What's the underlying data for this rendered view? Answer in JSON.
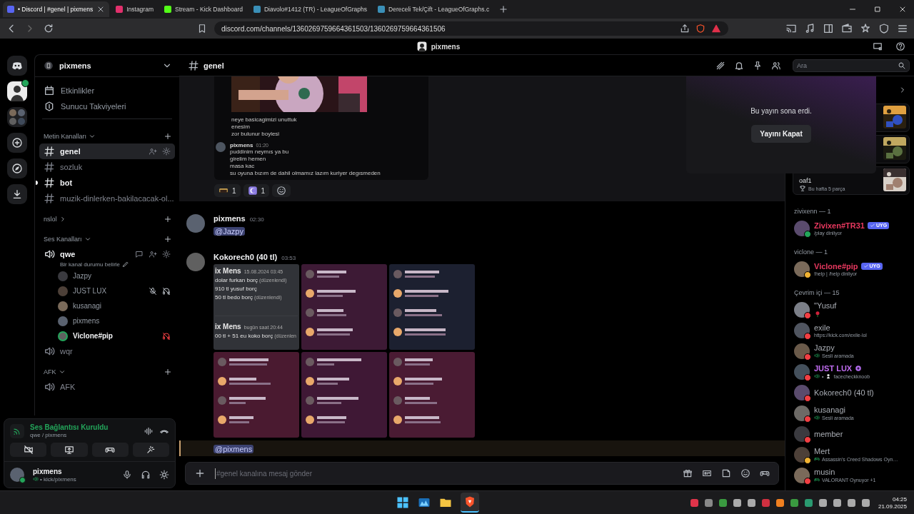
{
  "browser": {
    "tabs": [
      {
        "label": "• Discord | #genel | pixmens",
        "selected": true
      },
      {
        "label": "Instagram",
        "selected": false
      },
      {
        "label": "Stream - Kick Dashboard",
        "selected": false
      },
      {
        "label": "Diavolo#1412 (TR) - LeagueOfGraphs",
        "selected": false
      },
      {
        "label": "Dereceli Tek/Çift - LeagueOfGraphs.c",
        "selected": false
      }
    ],
    "url": "discord.com/channels/1360269759664361503/1360269759664361506"
  },
  "window_title": "pixmens",
  "server": {
    "name": "pixmens",
    "nav": [
      {
        "kind": "calendar",
        "label": "Etkinlikler"
      },
      {
        "kind": "boost",
        "label": "Sunucu Takviyeleri"
      }
    ],
    "categories": [
      {
        "name": "Metin Kanalları",
        "expanded": true,
        "channels": [
          {
            "kind": "text",
            "name": "genel",
            "selected": true,
            "unread": false
          },
          {
            "kind": "text",
            "name": "sozluk",
            "selected": false,
            "unread": false
          },
          {
            "kind": "text",
            "name": "bot",
            "selected": false,
            "unread": true
          },
          {
            "kind": "text",
            "name": "muzik-dinlerken-bakilacacak-ol...",
            "selected": false,
            "unread": false
          }
        ]
      },
      {
        "name": "nslol",
        "expanded": false
      },
      {
        "name": "Ses Kanalları",
        "expanded": true,
        "channels": [
          {
            "kind": "voice",
            "name": "qwe",
            "selected": false,
            "unread": true,
            "status_hint": "Bir kanal durumu belirle",
            "users": [
              {
                "name": "Jazpy",
                "speaking": false,
                "self_muted": false,
                "server_deafened": false
              },
              {
                "name": "JUST LUX",
                "speaking": false,
                "self_muted": true,
                "server_deafened": false
              },
              {
                "name": "kusanagi",
                "speaking": false,
                "self_muted": false,
                "server_deafened": false
              },
              {
                "name": "pixmens",
                "speaking": false,
                "self_muted": false,
                "server_deafened": false
              },
              {
                "name": "Viclone#pip",
                "speaking": true,
                "self_muted": false,
                "server_deafened": true
              }
            ]
          },
          {
            "kind": "voice",
            "name": "wqr",
            "selected": false,
            "unread": false
          }
        ]
      },
      {
        "name": "AFK",
        "expanded": true,
        "channels": [
          {
            "kind": "voice",
            "name": "AFK",
            "selected": false,
            "unread": false
          }
        ]
      }
    ]
  },
  "voice_panel": {
    "status": "Ses Bağlantısı Kuruldu",
    "location": "qwe / pixmens"
  },
  "user_panel": {
    "name": "pixmens",
    "status_text": "• kick/pixmens"
  },
  "header": {
    "channel": "genel",
    "search": {
      "placeholder": "Ara"
    }
  },
  "chat": {
    "embed": {
      "lines": [
        "neye basicagimizi unuttuk",
        "enesim",
        "zor bulunur boylesi"
      ],
      "quoted": {
        "author": "pixmens",
        "time": "01:20",
        "lines": [
          "puddinim neymıs ya bu",
          "girelim hemen",
          "masa kac",
          "su oyuna bızım de dahil olmamız lazım kuriyer degısmeden"
        ]
      }
    },
    "reactions": [
      {
        "count": "1"
      },
      {
        "count": "1"
      }
    ],
    "messages": [
      {
        "author": "pixmens",
        "time": "02:30",
        "mention": "@Jazpy",
        "highlighted": false
      },
      {
        "author": "Kokorech0 (40 tl)",
        "time": "03:53",
        "highlighted": false,
        "attachments": [
          {
            "kind": "screenshot",
            "posts": [
              {
                "author": "ix Mens",
                "time": "15.08.2024 03:45",
                "lines": [
                  {
                    "text": "dolar furkan borç",
                    "note": "(düzenlendi)"
                  },
                  {
                    "text": "910 tl yusuf borç"
                  },
                  {
                    "text": "50 tl bedo borç",
                    "note": "(düzenlendi)"
                  }
                ]
              },
              {
                "author": "ix Mens",
                "time": "bugün saat 20:44",
                "lines": [
                  {
                    "text": "00 tl + 51 eu koko borç",
                    "note": "(düzenlen"
                  }
                ]
              }
            ]
          },
          {
            "kind": "picture"
          },
          {
            "kind": "picture"
          },
          {
            "kind": "picture"
          },
          {
            "kind": "picture"
          },
          {
            "kind": "picture"
          }
        ]
      },
      {
        "mention": "@pixmens",
        "highlighted": true
      }
    ],
    "input": {
      "placeholder": "#genel kanalına mesaj gönder"
    }
  },
  "stream_end": {
    "message": "Bu yayın sona erdi.",
    "button": "Yayını Kapat"
  },
  "members": {
    "activity_cards": [
      {
        "kind": "picture"
      },
      {
        "kind": "picture"
      },
      {
        "kind": "picture",
        "title": "oaf1",
        "subtitle": "Bu hafta 5 parça"
      }
    ],
    "groups": [
      {
        "title": "zivixenn — 1",
        "members": [
          {
            "name": "Zivixen#TR31",
            "color": "#e8385f",
            "status": {
              "color": "#23a55a"
            },
            "tag": "UYG",
            "badge": false,
            "activity": {
              "kind": "text",
              "text": "/play dinliyor"
            }
          }
        ]
      },
      {
        "title": "viclone — 1",
        "members": [
          {
            "name": "Viclone#pip",
            "color": "#e8385f",
            "status": {
              "color": "#f0b232"
            },
            "tag": "UYG",
            "badge": false,
            "activity": {
              "kind": "text",
              "text": "!help | /help dinliyor"
            }
          }
        ]
      },
      {
        "title": "Çevrim içi — 15",
        "members": [
          {
            "name": "\"Yusuf",
            "color": "#a9adb4",
            "status": {
              "color": "#f23f43"
            },
            "badge": false,
            "activity": {
              "kind": "rose"
            }
          },
          {
            "name": "exile",
            "color": "#a9adb4",
            "status": {
              "color": "#f23f43"
            },
            "badge": false,
            "activity": {
              "kind": "text",
              "text": "https://kick.com/exile-lol"
            }
          },
          {
            "name": "Jazpy",
            "color": "#a9adb4",
            "status": {
              "color": "#f23f43"
            },
            "badge": false,
            "activity": {
              "kind": "voice",
              "text": "Sesli aramada"
            }
          },
          {
            "name": "JUST LUX",
            "color": "#c06cf0",
            "status": {
              "color": "#f23f43"
            },
            "badge": true,
            "activity": {
              "kind": "voice_stream",
              "prefix": "•",
              "text": "facecheckknoob"
            }
          },
          {
            "name": "Kokorech0 (40 tl)",
            "color": "#a9adb4",
            "status": {
              "color": "#f23f43"
            },
            "badge": false
          },
          {
            "name": "kusanagi",
            "color": "#a9adb4",
            "status": {
              "color": "#f23f43"
            },
            "badge": false,
            "activity": {
              "kind": "voice",
              "text": "Sesli aramada"
            }
          },
          {
            "name": "member",
            "color": "#a9adb4",
            "status": {
              "color": "#f23f43"
            },
            "badge": false
          },
          {
            "name": "Mert",
            "color": "#a9adb4",
            "status": {
              "color": "#f0b232"
            },
            "badge": false,
            "activity": {
              "kind": "game",
              "text": "Assassin's Creed Shadows Oyn…"
            }
          },
          {
            "name": "musin",
            "color": "#a9adb4",
            "status": {
              "color": "#f23f43"
            },
            "badge": false,
            "activity": {
              "kind": "game",
              "text": "VALORANT Oynuyor +1"
            }
          }
        ]
      }
    ]
  },
  "taskbar": {
    "time": "04:25",
    "date": "21.09.2025"
  }
}
